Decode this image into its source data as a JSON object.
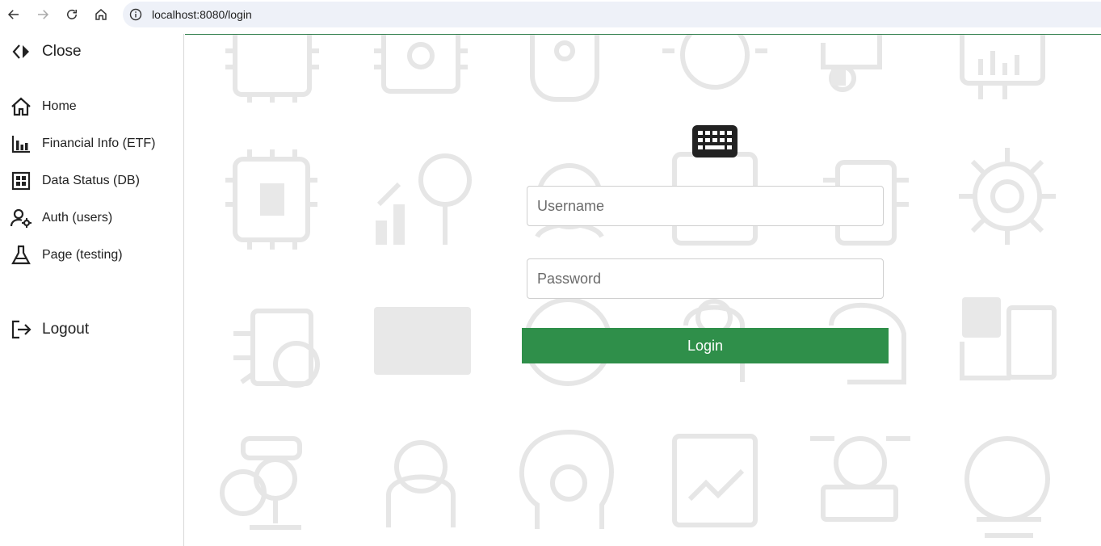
{
  "browser": {
    "url": "localhost:8080/login",
    "icons": [
      "back-icon",
      "forward-icon",
      "reload-icon",
      "home-icon",
      "info-icon"
    ]
  },
  "sidebar": {
    "close_label": "Close",
    "items": [
      {
        "label": "Home",
        "icon": "home-icon"
      },
      {
        "label": "Financial Info (ETF)",
        "icon": "bar-chart-icon"
      },
      {
        "label": "Data Status (DB)",
        "icon": "grid-icon"
      },
      {
        "label": "Auth (users)",
        "icon": "user-gear-icon"
      },
      {
        "label": "Page (testing)",
        "icon": "flask-icon"
      }
    ],
    "logout_label": "Logout"
  },
  "login": {
    "icon": "keyboard-icon",
    "username_placeholder": "Username",
    "password_placeholder": "Password",
    "button_label": "Login"
  },
  "colors": {
    "primary": "#2f8f4a",
    "background_art": "#e6e6e6"
  }
}
